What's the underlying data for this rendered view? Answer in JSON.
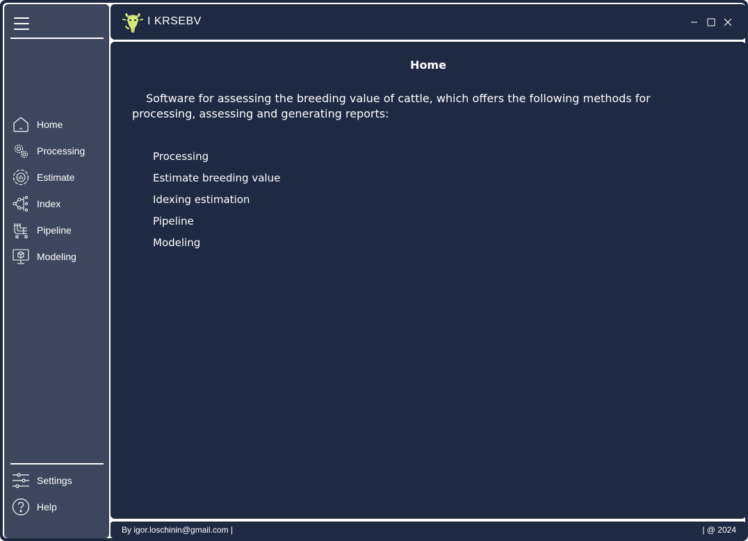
{
  "app": {
    "name": "I KRSEBV",
    "logo_icon": "bull-logo-icon"
  },
  "sidebar": {
    "menu_icon": "hamburger-icon",
    "items": [
      {
        "label": "Home",
        "icon": "home-icon"
      },
      {
        "label": "Processing",
        "icon": "gears-icon"
      },
      {
        "label": "Estimate",
        "icon": "estimate-icon"
      },
      {
        "label": "Index",
        "icon": "index-icon"
      },
      {
        "label": "Pipeline",
        "icon": "pipeline-icon"
      },
      {
        "label": "Modeling",
        "icon": "modeling-icon"
      }
    ],
    "bottom_items": [
      {
        "label": "Settings",
        "icon": "sliders-icon"
      },
      {
        "label": "Help",
        "icon": "help-icon"
      }
    ]
  },
  "window_controls": [
    "minimize-icon",
    "maximize-icon",
    "close-icon"
  ],
  "main": {
    "title": "Home",
    "description": "Software for assessing the breeding value of cattle, which offers the following methods for processing, assessing and generating reports:",
    "methods": [
      "Processing",
      "Estimate breeding value",
      "Idexing estimation",
      "Pipeline",
      "Modeling"
    ]
  },
  "footer": {
    "left": "By igor.loschinin@gmail.com |",
    "right": "| @ 2024"
  },
  "colors": {
    "sidebar_bg": "#3c475d",
    "panel_bg": "#1e2a42",
    "logo_accent": "#d7e87a",
    "text": "#ffffff"
  }
}
